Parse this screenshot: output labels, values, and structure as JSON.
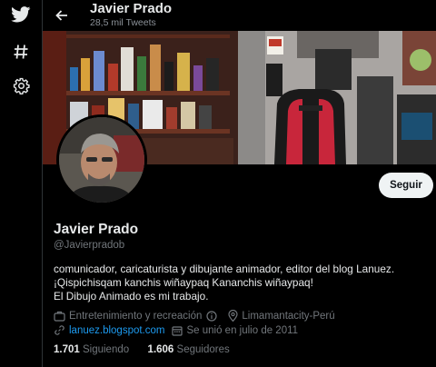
{
  "topbar": {
    "name": "Javier Prado",
    "tweet_count": "28,5 mil Tweets"
  },
  "profile": {
    "name": "Javier Prado",
    "handle": "@Javierpradob",
    "follow_label": "Seguir",
    "bio_lines": [
      "comunicador, caricaturista y dibujante animador,  editor del blog Lanuez.",
      "¡Qispichisqam kanchis wiñaypaq Kananchis wiñaypaq!",
      "El Dibujo Animado es mi trabajo."
    ],
    "category": "Entretenimiento y recreación",
    "location": "Limamantacity-Perú",
    "website": "lanuez.blogspot.com",
    "joined": "Se unió en julio de 2011",
    "following_count": "1.701",
    "following_label": "Siguiendo",
    "followers_count": "1.606",
    "followers_label": "Seguidores"
  },
  "nav": {
    "icons": [
      "twitter-bird-icon",
      "hashtag-icon",
      "settings-gear-icon"
    ]
  },
  "colors": {
    "background": "#000000",
    "link": "#1d9bf0",
    "text": "#e7e9ea",
    "secondary_text": "#71767b",
    "button_bg": "#eff3f4"
  }
}
